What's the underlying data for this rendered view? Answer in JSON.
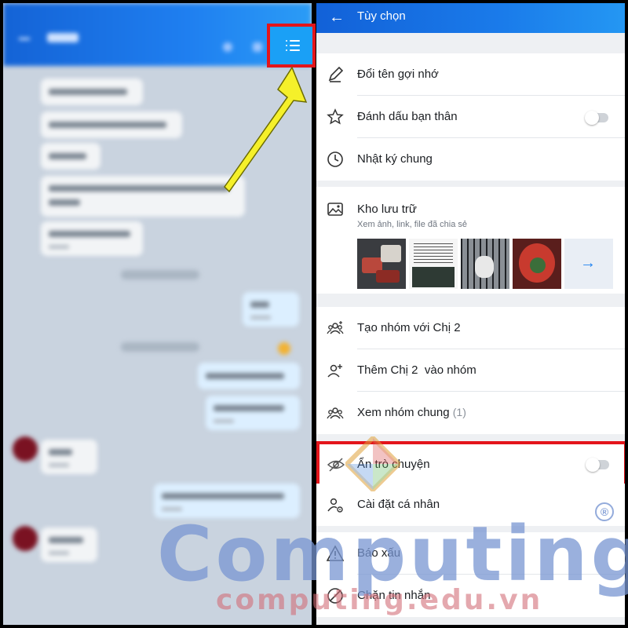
{
  "header": {
    "title": "Tùy chọn"
  },
  "menu": {
    "rename": "Đổi tên gợi nhớ",
    "mark_friend": "Đánh dấu bạn thân",
    "shared_diary": "Nhật ký chung",
    "storage_title": "Kho lưu trữ",
    "storage_subtitle": "Xem ảnh, link, file đã chia sẻ",
    "create_group": "Tạo nhóm với Chị 2",
    "add_to_group": "Thêm Chị 2  vào nhóm",
    "common_groups": "Xem nhóm chung",
    "common_groups_count": "(1)",
    "hide_chat": "Ẩn trò chuyện",
    "personal_settings": "Cài đặt cá nhân",
    "report": "Báo xấu",
    "block": "Chặn tin nhắn"
  },
  "toggles": {
    "mark_friend_on": false,
    "hide_chat_on": false
  },
  "icons": [
    "back-arrow-icon",
    "pencil-icon",
    "star-icon",
    "clock-icon",
    "image-icon",
    "group-add-icon",
    "person-add-icon",
    "group-icon",
    "eye-off-icon",
    "person-gear-icon",
    "warning-icon",
    "block-icon",
    "arrow-right-icon",
    "menu-list-icon"
  ],
  "watermark": {
    "brand": "Computing",
    "url": "computing.edu.vn",
    "reg": "®"
  },
  "colors": {
    "accent": "#1a7bea",
    "highlight": "#e3151b",
    "arrow": "#f5f02a"
  }
}
